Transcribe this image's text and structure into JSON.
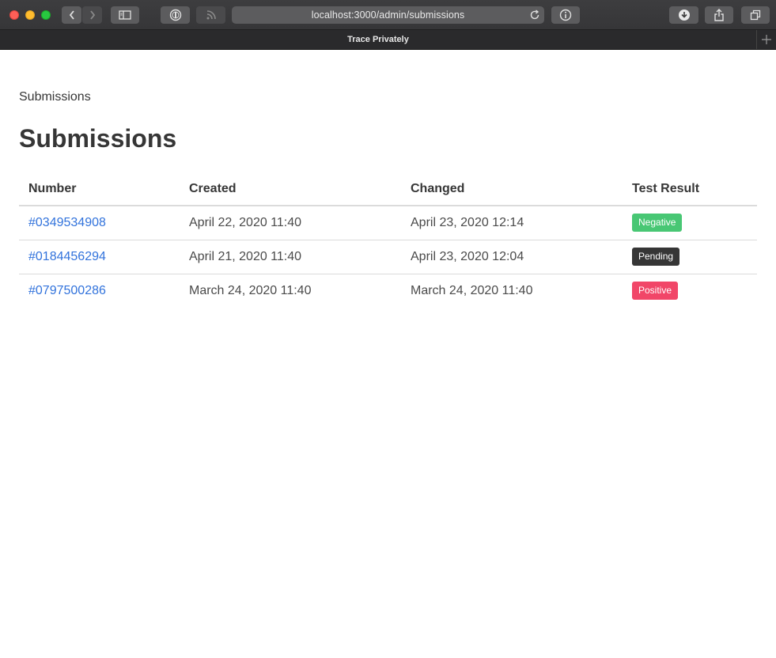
{
  "browser": {
    "url": "localhost:3000/admin/submissions",
    "tab_title": "Trace Privately",
    "icons": [
      "back-icon",
      "forward-icon",
      "sidebar-icon",
      "password-manager-icon",
      "rss-icon",
      "reload-icon",
      "info-icon",
      "download-icon",
      "share-icon",
      "tabs-overview-icon",
      "new-tab-icon"
    ]
  },
  "page": {
    "breadcrumb": "Submissions",
    "title": "Submissions"
  },
  "table": {
    "headers": [
      "Number",
      "Created",
      "Changed",
      "Test Result"
    ],
    "rows": [
      {
        "number": "#0349534908",
        "created": "April 22, 2020 11:40",
        "changed": "April 23, 2020 12:14",
        "result": "Negative",
        "result_color": "#48c774"
      },
      {
        "number": "#0184456294",
        "created": "April 21, 2020 11:40",
        "changed": "April 23, 2020 12:04",
        "result": "Pending",
        "result_color": "#363636"
      },
      {
        "number": "#0797500286",
        "created": "March 24, 2020 11:40",
        "changed": "March 24, 2020 11:40",
        "result": "Positive",
        "result_color": "#f14668"
      }
    ]
  },
  "colors": {
    "link": "#3273dc",
    "text": "#363636"
  }
}
